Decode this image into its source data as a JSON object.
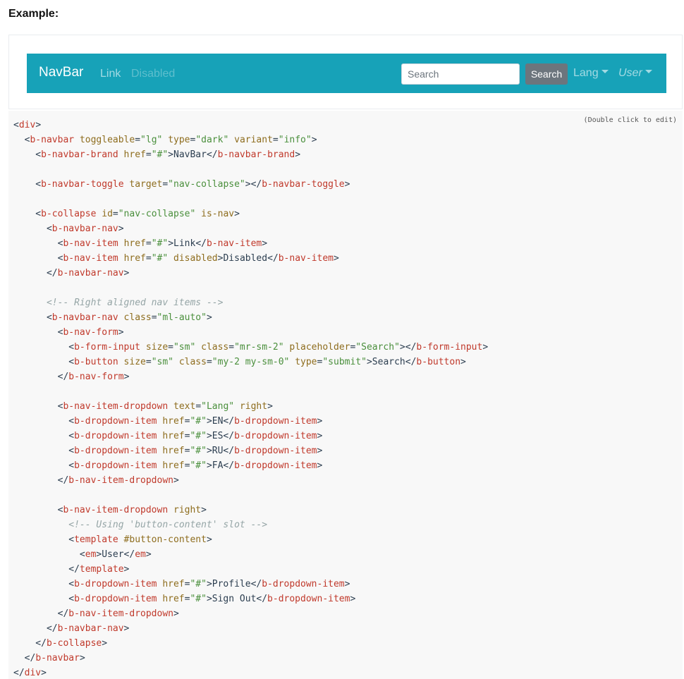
{
  "example_label": "Example:",
  "navbar": {
    "brand": "NavBar",
    "link": "Link",
    "disabled_link": "Disabled",
    "search_placeholder": "Search",
    "search_button": "Search",
    "lang_dropdown": "Lang",
    "user_dropdown": "User"
  },
  "code_hint": "(Double click to edit)",
  "colors": {
    "navbar_bg": "#17a2b8",
    "button_bg": "#6c757d",
    "code_bg": "#f8f8f8",
    "tag": "#c0392b",
    "attr": "#8e6d1e",
    "value": "#4a8f3c",
    "comment": "#95a5a6"
  },
  "code_lines": [
    [
      [
        "p",
        "<"
      ],
      [
        "t",
        "div"
      ],
      [
        "p",
        ">"
      ]
    ],
    [
      [
        "p",
        "  <"
      ],
      [
        "t",
        "b-navbar"
      ],
      [
        "p",
        " "
      ],
      [
        "a",
        "toggleable"
      ],
      [
        "p",
        "="
      ],
      [
        "v",
        "\"lg\""
      ],
      [
        "p",
        " "
      ],
      [
        "a",
        "type"
      ],
      [
        "p",
        "="
      ],
      [
        "v",
        "\"dark\""
      ],
      [
        "p",
        " "
      ],
      [
        "a",
        "variant"
      ],
      [
        "p",
        "="
      ],
      [
        "v",
        "\"info\""
      ],
      [
        "p",
        ">"
      ]
    ],
    [
      [
        "p",
        "    <"
      ],
      [
        "t",
        "b-navbar-brand"
      ],
      [
        "p",
        " "
      ],
      [
        "a",
        "href"
      ],
      [
        "p",
        "="
      ],
      [
        "v",
        "\"#\""
      ],
      [
        "p",
        ">NavBar</"
      ],
      [
        "t",
        "b-navbar-brand"
      ],
      [
        "p",
        ">"
      ]
    ],
    [],
    [
      [
        "p",
        "    <"
      ],
      [
        "t",
        "b-navbar-toggle"
      ],
      [
        "p",
        " "
      ],
      [
        "a",
        "target"
      ],
      [
        "p",
        "="
      ],
      [
        "v",
        "\"nav-collapse\""
      ],
      [
        "p",
        "></"
      ],
      [
        "t",
        "b-navbar-toggle"
      ],
      [
        "p",
        ">"
      ]
    ],
    [],
    [
      [
        "p",
        "    <"
      ],
      [
        "t",
        "b-collapse"
      ],
      [
        "p",
        " "
      ],
      [
        "a",
        "id"
      ],
      [
        "p",
        "="
      ],
      [
        "v",
        "\"nav-collapse\""
      ],
      [
        "p",
        " "
      ],
      [
        "a",
        "is-nav"
      ],
      [
        "p",
        ">"
      ]
    ],
    [
      [
        "p",
        "      <"
      ],
      [
        "t",
        "b-navbar-nav"
      ],
      [
        "p",
        ">"
      ]
    ],
    [
      [
        "p",
        "        <"
      ],
      [
        "t",
        "b-nav-item"
      ],
      [
        "p",
        " "
      ],
      [
        "a",
        "href"
      ],
      [
        "p",
        "="
      ],
      [
        "v",
        "\"#\""
      ],
      [
        "p",
        ">Link</"
      ],
      [
        "t",
        "b-nav-item"
      ],
      [
        "p",
        ">"
      ]
    ],
    [
      [
        "p",
        "        <"
      ],
      [
        "t",
        "b-nav-item"
      ],
      [
        "p",
        " "
      ],
      [
        "a",
        "href"
      ],
      [
        "p",
        "="
      ],
      [
        "v",
        "\"#\""
      ],
      [
        "p",
        " "
      ],
      [
        "a",
        "disabled"
      ],
      [
        "p",
        ">Disabled</"
      ],
      [
        "t",
        "b-nav-item"
      ],
      [
        "p",
        ">"
      ]
    ],
    [
      [
        "p",
        "      </"
      ],
      [
        "t",
        "b-navbar-nav"
      ],
      [
        "p",
        ">"
      ]
    ],
    [],
    [
      [
        "p",
        "      "
      ],
      [
        "c",
        "<!-- Right aligned nav items -->"
      ]
    ],
    [
      [
        "p",
        "      <"
      ],
      [
        "t",
        "b-navbar-nav"
      ],
      [
        "p",
        " "
      ],
      [
        "a",
        "class"
      ],
      [
        "p",
        "="
      ],
      [
        "v",
        "\"ml-auto\""
      ],
      [
        "p",
        ">"
      ]
    ],
    [
      [
        "p",
        "        <"
      ],
      [
        "t",
        "b-nav-form"
      ],
      [
        "p",
        ">"
      ]
    ],
    [
      [
        "p",
        "          <"
      ],
      [
        "t",
        "b-form-input"
      ],
      [
        "p",
        " "
      ],
      [
        "a",
        "size"
      ],
      [
        "p",
        "="
      ],
      [
        "v",
        "\"sm\""
      ],
      [
        "p",
        " "
      ],
      [
        "a",
        "class"
      ],
      [
        "p",
        "="
      ],
      [
        "v",
        "\"mr-sm-2\""
      ],
      [
        "p",
        " "
      ],
      [
        "a",
        "placeholder"
      ],
      [
        "p",
        "="
      ],
      [
        "v",
        "\"Search\""
      ],
      [
        "p",
        "></"
      ],
      [
        "t",
        "b-form-input"
      ],
      [
        "p",
        ">"
      ]
    ],
    [
      [
        "p",
        "          <"
      ],
      [
        "t",
        "b-button"
      ],
      [
        "p",
        " "
      ],
      [
        "a",
        "size"
      ],
      [
        "p",
        "="
      ],
      [
        "v",
        "\"sm\""
      ],
      [
        "p",
        " "
      ],
      [
        "a",
        "class"
      ],
      [
        "p",
        "="
      ],
      [
        "v",
        "\"my-2 my-sm-0\""
      ],
      [
        "p",
        " "
      ],
      [
        "a",
        "type"
      ],
      [
        "p",
        "="
      ],
      [
        "v",
        "\"submit\""
      ],
      [
        "p",
        ">Search</"
      ],
      [
        "t",
        "b-button"
      ],
      [
        "p",
        ">"
      ]
    ],
    [
      [
        "p",
        "        </"
      ],
      [
        "t",
        "b-nav-form"
      ],
      [
        "p",
        ">"
      ]
    ],
    [],
    [
      [
        "p",
        "        <"
      ],
      [
        "t",
        "b-nav-item-dropdown"
      ],
      [
        "p",
        " "
      ],
      [
        "a",
        "text"
      ],
      [
        "p",
        "="
      ],
      [
        "v",
        "\"Lang\""
      ],
      [
        "p",
        " "
      ],
      [
        "a",
        "right"
      ],
      [
        "p",
        ">"
      ]
    ],
    [
      [
        "p",
        "          <"
      ],
      [
        "t",
        "b-dropdown-item"
      ],
      [
        "p",
        " "
      ],
      [
        "a",
        "href"
      ],
      [
        "p",
        "="
      ],
      [
        "v",
        "\"#\""
      ],
      [
        "p",
        ">EN</"
      ],
      [
        "t",
        "b-dropdown-item"
      ],
      [
        "p",
        ">"
      ]
    ],
    [
      [
        "p",
        "          <"
      ],
      [
        "t",
        "b-dropdown-item"
      ],
      [
        "p",
        " "
      ],
      [
        "a",
        "href"
      ],
      [
        "p",
        "="
      ],
      [
        "v",
        "\"#\""
      ],
      [
        "p",
        ">ES</"
      ],
      [
        "t",
        "b-dropdown-item"
      ],
      [
        "p",
        ">"
      ]
    ],
    [
      [
        "p",
        "          <"
      ],
      [
        "t",
        "b-dropdown-item"
      ],
      [
        "p",
        " "
      ],
      [
        "a",
        "href"
      ],
      [
        "p",
        "="
      ],
      [
        "v",
        "\"#\""
      ],
      [
        "p",
        ">RU</"
      ],
      [
        "t",
        "b-dropdown-item"
      ],
      [
        "p",
        ">"
      ]
    ],
    [
      [
        "p",
        "          <"
      ],
      [
        "t",
        "b-dropdown-item"
      ],
      [
        "p",
        " "
      ],
      [
        "a",
        "href"
      ],
      [
        "p",
        "="
      ],
      [
        "v",
        "\"#\""
      ],
      [
        "p",
        ">FA</"
      ],
      [
        "t",
        "b-dropdown-item"
      ],
      [
        "p",
        ">"
      ]
    ],
    [
      [
        "p",
        "        </"
      ],
      [
        "t",
        "b-nav-item-dropdown"
      ],
      [
        "p",
        ">"
      ]
    ],
    [],
    [
      [
        "p",
        "        <"
      ],
      [
        "t",
        "b-nav-item-dropdown"
      ],
      [
        "p",
        " "
      ],
      [
        "a",
        "right"
      ],
      [
        "p",
        ">"
      ]
    ],
    [
      [
        "p",
        "          "
      ],
      [
        "c",
        "<!-- Using 'button-content' slot -->"
      ]
    ],
    [
      [
        "p",
        "          <"
      ],
      [
        "t",
        "template"
      ],
      [
        "p",
        " "
      ],
      [
        "a",
        "#button-content"
      ],
      [
        "p",
        ">"
      ]
    ],
    [
      [
        "p",
        "            <"
      ],
      [
        "t",
        "em"
      ],
      [
        "p",
        ">User</"
      ],
      [
        "t",
        "em"
      ],
      [
        "p",
        ">"
      ]
    ],
    [
      [
        "p",
        "          </"
      ],
      [
        "t",
        "template"
      ],
      [
        "p",
        ">"
      ]
    ],
    [
      [
        "p",
        "          <"
      ],
      [
        "t",
        "b-dropdown-item"
      ],
      [
        "p",
        " "
      ],
      [
        "a",
        "href"
      ],
      [
        "p",
        "="
      ],
      [
        "v",
        "\"#\""
      ],
      [
        "p",
        ">Profile</"
      ],
      [
        "t",
        "b-dropdown-item"
      ],
      [
        "p",
        ">"
      ]
    ],
    [
      [
        "p",
        "          <"
      ],
      [
        "t",
        "b-dropdown-item"
      ],
      [
        "p",
        " "
      ],
      [
        "a",
        "href"
      ],
      [
        "p",
        "="
      ],
      [
        "v",
        "\"#\""
      ],
      [
        "p",
        ">Sign Out</"
      ],
      [
        "t",
        "b-dropdown-item"
      ],
      [
        "p",
        ">"
      ]
    ],
    [
      [
        "p",
        "        </"
      ],
      [
        "t",
        "b-nav-item-dropdown"
      ],
      [
        "p",
        ">"
      ]
    ],
    [
      [
        "p",
        "      </"
      ],
      [
        "t",
        "b-navbar-nav"
      ],
      [
        "p",
        ">"
      ]
    ],
    [
      [
        "p",
        "    </"
      ],
      [
        "t",
        "b-collapse"
      ],
      [
        "p",
        ">"
      ]
    ],
    [
      [
        "p",
        "  </"
      ],
      [
        "t",
        "b-navbar"
      ],
      [
        "p",
        ">"
      ]
    ],
    [
      [
        "p",
        "</"
      ],
      [
        "t",
        "div"
      ],
      [
        "p",
        ">"
      ]
    ]
  ]
}
